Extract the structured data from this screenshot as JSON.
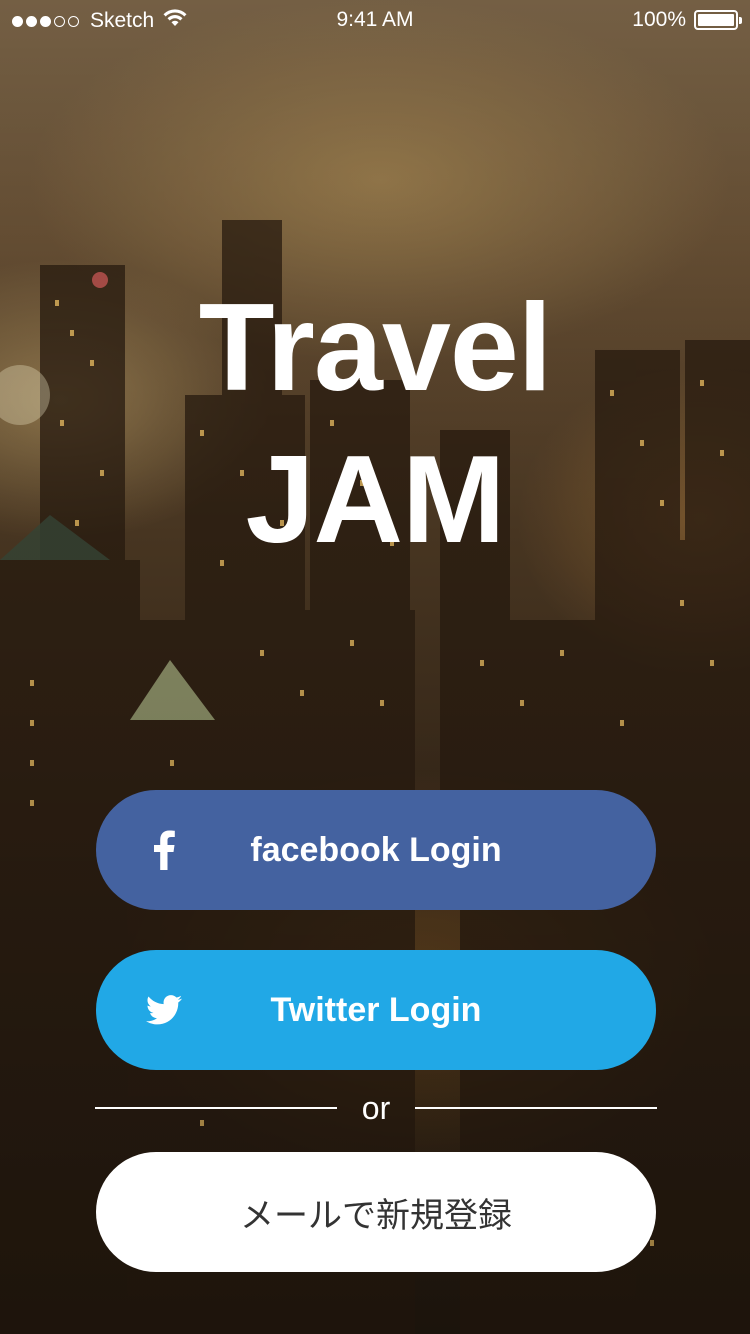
{
  "status_bar": {
    "carrier": "Sketch",
    "time": "9:41 AM",
    "battery": "100%",
    "signal_bars_filled": 3,
    "signal_bars_total": 5
  },
  "app": {
    "title_line1": "Travel",
    "title_line2": "JAM"
  },
  "buttons": {
    "facebook": {
      "label": "facebook Login",
      "icon": "facebook-icon",
      "color": "#4462a0"
    },
    "twitter": {
      "label": "Twitter Login",
      "icon": "twitter-icon",
      "color": "#21a8e6"
    },
    "email": {
      "label": "メールで新規登録",
      "color": "#ffffff"
    }
  },
  "divider": {
    "text": "or"
  }
}
